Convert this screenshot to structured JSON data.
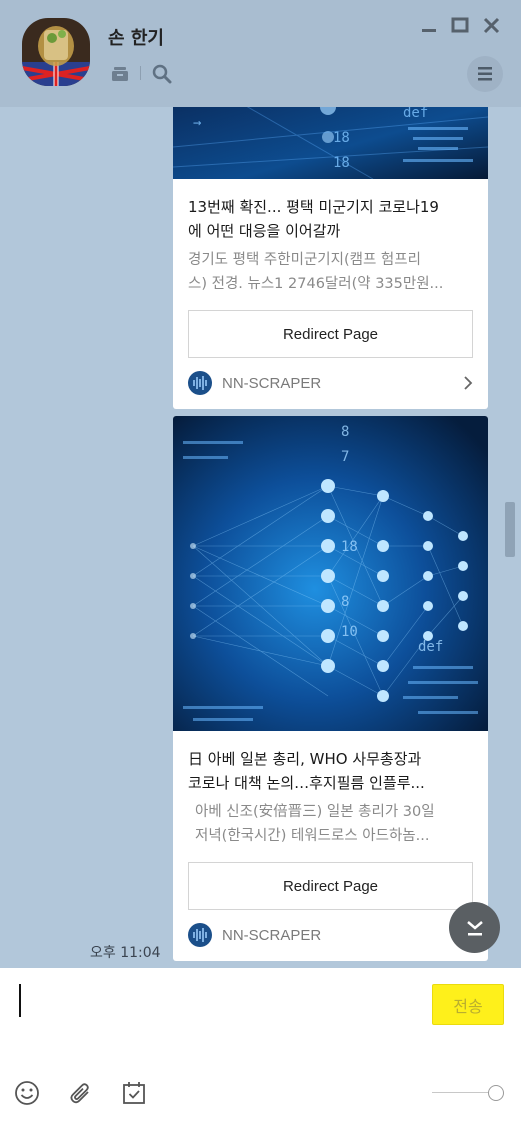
{
  "window": {
    "title": "손 한기",
    "icons": [
      "avatar",
      "archive-icon",
      "search-icon",
      "minimize-icon",
      "maximize-icon",
      "close-icon",
      "menu-icon"
    ]
  },
  "messages": [
    {
      "title_line1": "13번째 확진... 평택 미군기지 코로나19",
      "title_line2": "에 어떤 대응을 이어갈까",
      "desc_line1": "경기도 평택 주한미군기지(캠프 험프리",
      "desc_line2": "스) 전경. 뉴스1 2746달러(약 335만원...",
      "button_label": "Redirect Page",
      "source_name": "NN-SCRAPER"
    },
    {
      "title_line1": "日 아베 일본 총리, WHO 사무총장과",
      "title_line2": "코로나 대책 논의…후지필름 인플루...",
      "desc_line1": "아베 신조(安倍晋三) 일본 총리가 30일",
      "desc_line2": "저녁(한국시간) 테워드로스 아드하놈...",
      "button_label": "Redirect Page",
      "source_name": "NN-SCRAPER"
    }
  ],
  "timestamp": "오후 11:04",
  "composer": {
    "send_label": "전송",
    "tools": [
      "emoji-icon",
      "attach-icon",
      "calendar-icon"
    ]
  },
  "colors": {
    "chat_bg": "#b2c7da",
    "header_bg": "#a9bdd0",
    "send_bg": "#fef01b"
  }
}
